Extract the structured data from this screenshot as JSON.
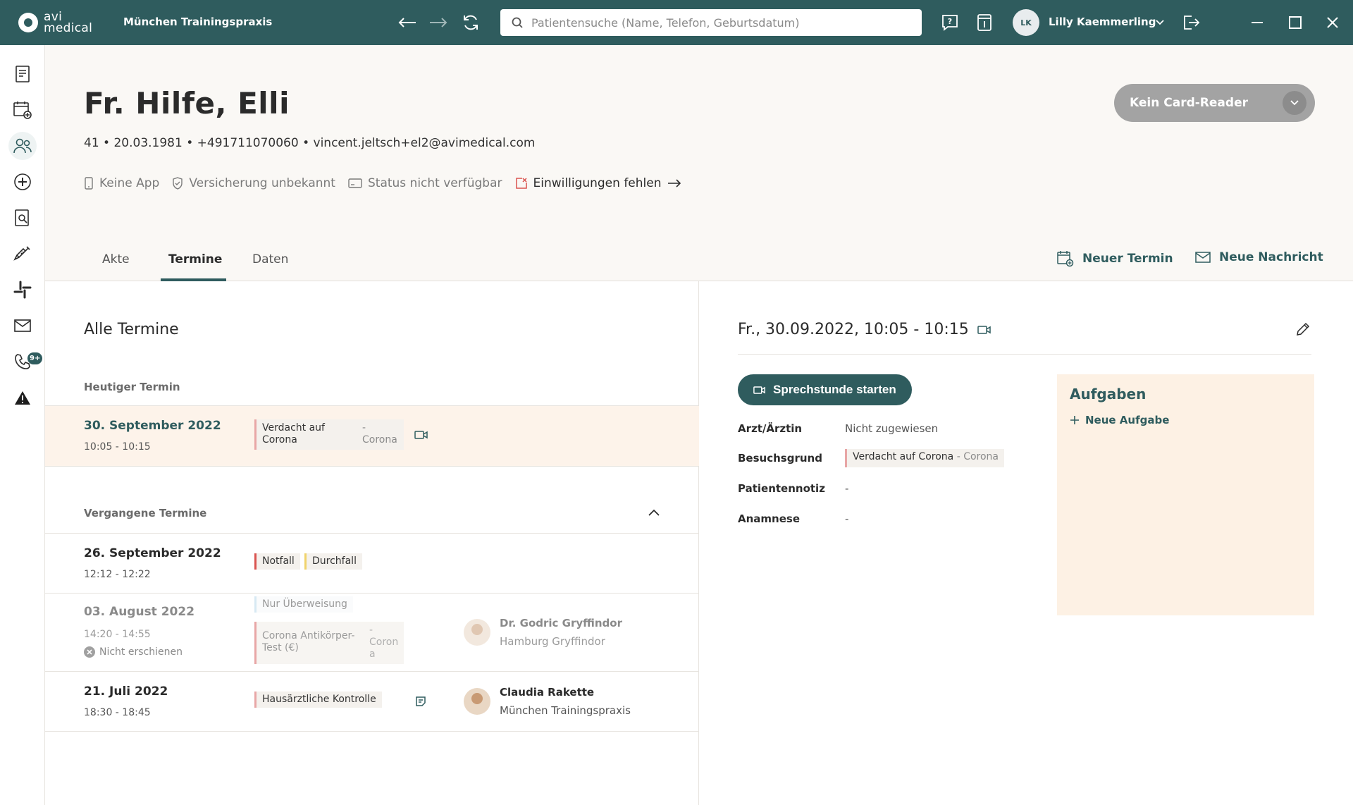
{
  "topbar": {
    "logo_line1": "avi",
    "logo_line2": "medical",
    "practice": "München Trainingspraxis",
    "search_placeholder": "Patientensuche (Name, Telefon, Geburtsdatum)",
    "user_initials": "LK",
    "user_name": "Lilly Kaemmerling"
  },
  "sidebar": {
    "message_badge": "9+"
  },
  "patient": {
    "name": "Fr. Hilfe, Elli",
    "meta": "41 • 20.03.1981 • +491711070060 • vincent.jeltsch+el2@avimedical.com",
    "status": {
      "app": "Keine App",
      "insurance": "Versicherung unbekannt",
      "availability": "Status nicht verfügbar",
      "consent": "Einwilligungen fehlen"
    },
    "card_reader": "Kein Card-Reader"
  },
  "tabs": [
    {
      "label": "Akte"
    },
    {
      "label": "Termine"
    },
    {
      "label": "Daten"
    }
  ],
  "actions": {
    "new_appointment": "Neuer Termin",
    "new_message": "Neue Nachricht"
  },
  "appointments": {
    "title": "Alle Termine",
    "today_header": "Heutiger Termin",
    "past_header": "Vergangene Termine",
    "today": {
      "date": "30. September 2022",
      "time": "10:05 - 10:15",
      "reason_line1": "Verdacht auf",
      "reason_line2": "Corona",
      "reason_sub1": "-",
      "reason_sub2": "Corona"
    },
    "past": [
      {
        "date": "26. September 2022",
        "time": "12:12 - 12:22",
        "tag1": "Notfall",
        "tag2": "Durchfall"
      },
      {
        "date": "03. August 2022",
        "time": "14:20 - 14:55",
        "status": "Nicht erschienen",
        "tag1": "Nur Überweisung",
        "tag2_line1": "Corona Antikörper-",
        "tag2_line2": "Test (€)",
        "tag2_sub1": "-",
        "tag2_sub2": "Coron",
        "tag2_sub3": "a",
        "doctor": "Dr. Godric Gryffindor",
        "location": "Hamburg Gryffindor"
      },
      {
        "date": "21. Juli 2022",
        "time": "18:30 - 18:45",
        "tag1": "Hausärztliche Kontrolle",
        "doctor": "Claudia Rakette",
        "location": "München Trainingspraxis"
      }
    ]
  },
  "detail": {
    "title": "Fr., 30.09.2022, 10:05 - 10:15",
    "start_button": "Sprechstunde starten",
    "fields": {
      "doctor_label": "Arzt/Ärztin",
      "doctor_value": "Nicht zugewiesen",
      "reason_label": "Besuchsgrund",
      "reason_value": "Verdacht auf Corona",
      "reason_sub": "- Corona",
      "note_label": "Patientennotiz",
      "note_value": "-",
      "anamnesis_label": "Anamnese",
      "anamnesis_value": "-"
    },
    "tasks_title": "Aufgaben",
    "tasks_add": "Neue Aufgabe"
  },
  "colors": {
    "brand": "#2f5c5e",
    "today_bg": "#fdf3ea",
    "tasks_bg": "#fdf1e4",
    "emergency": "#d9534f",
    "warning": "#f0d36b"
  }
}
